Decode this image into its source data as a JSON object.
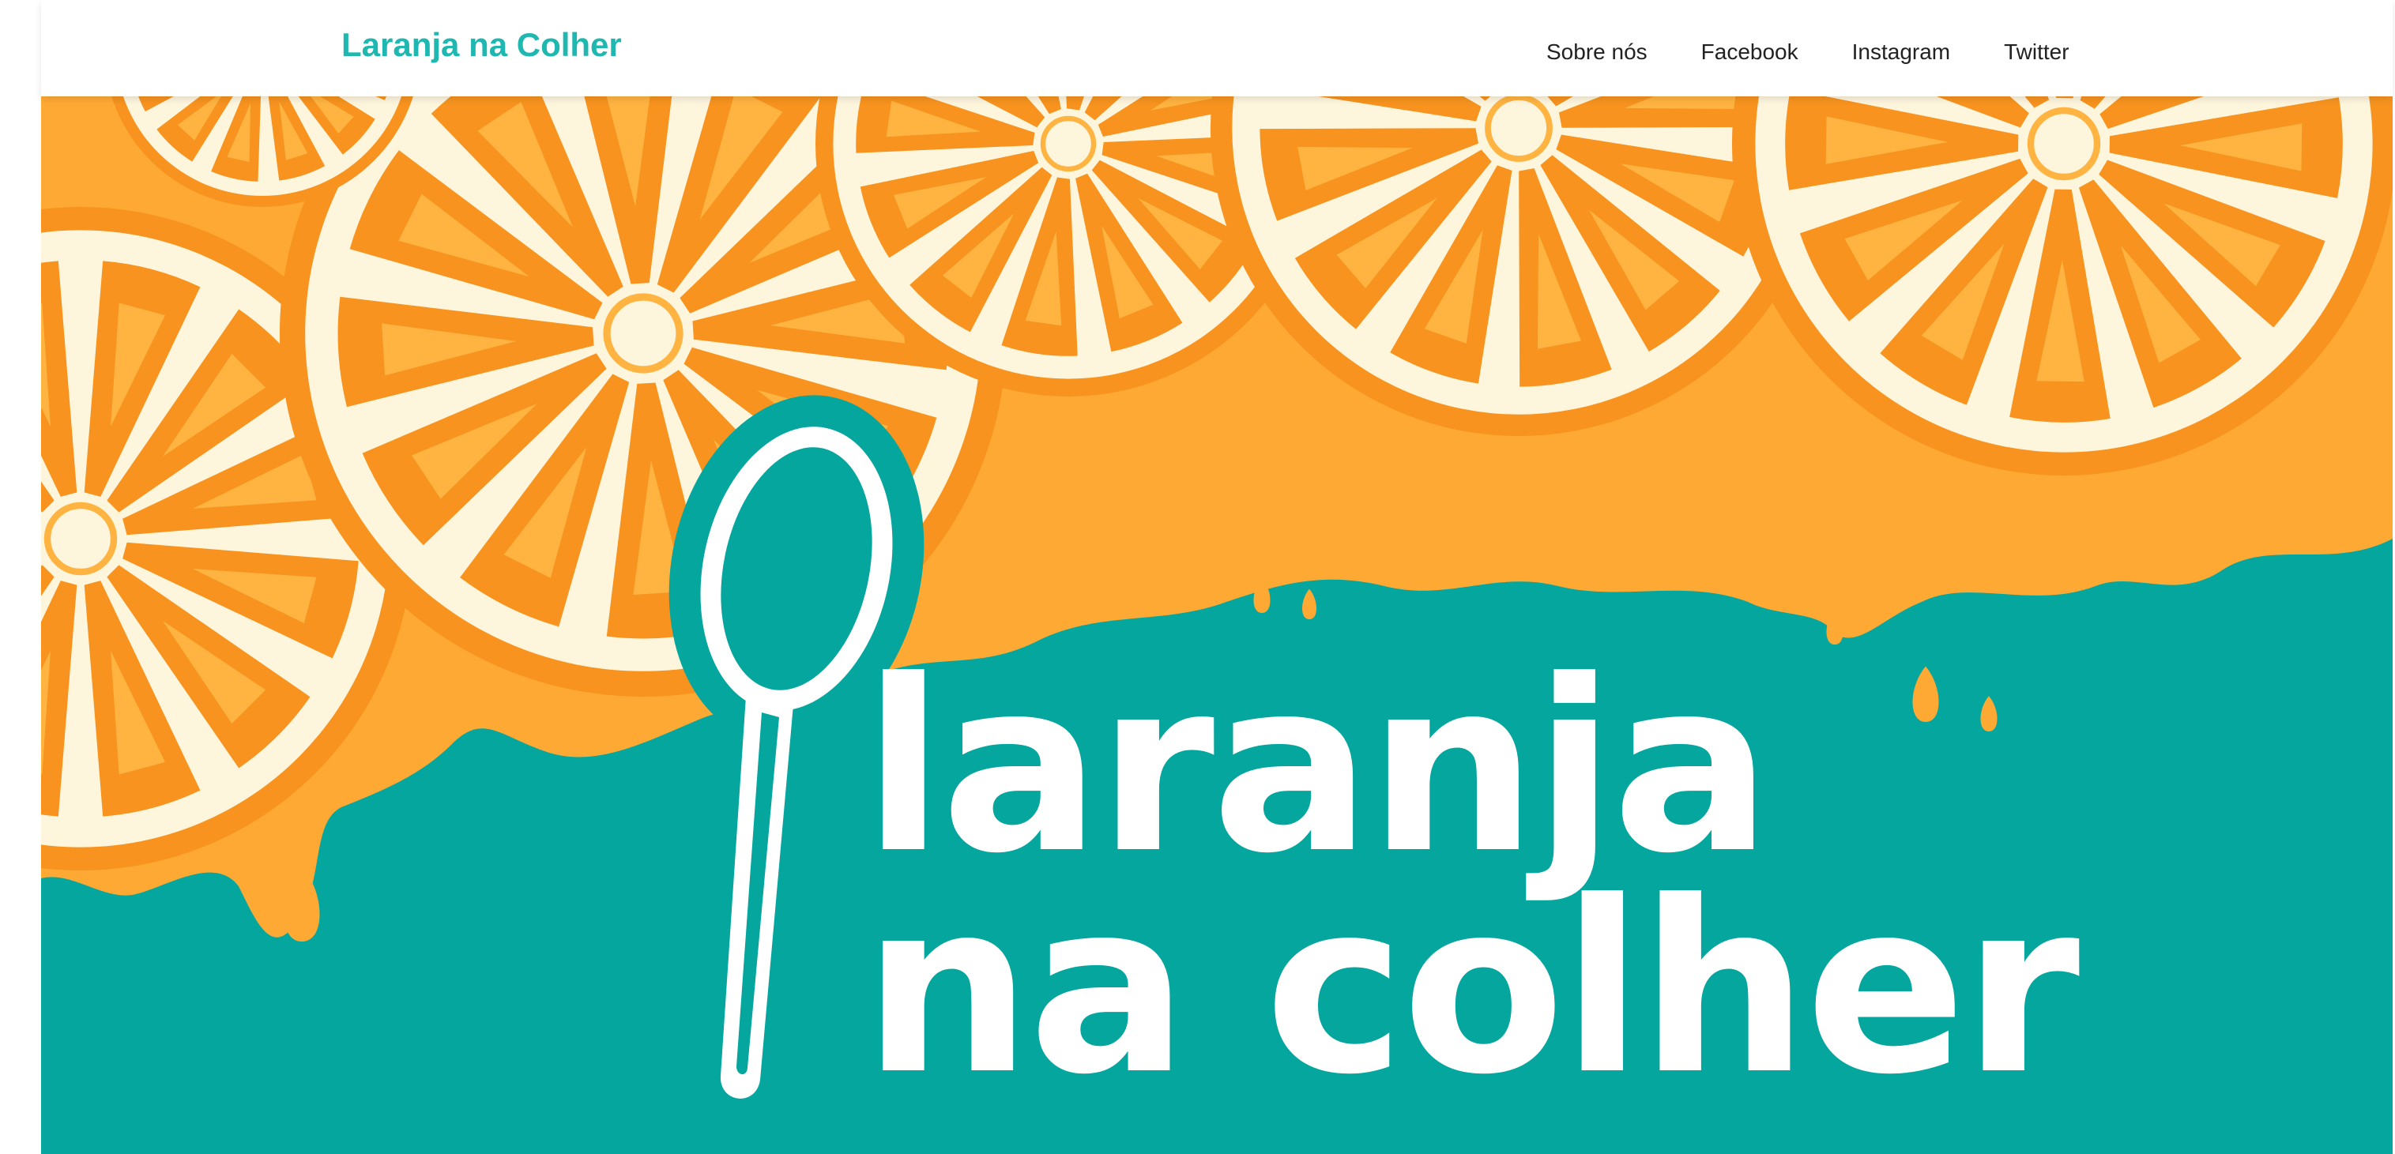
{
  "header": {
    "brand": "Laranja na Colher",
    "nav": [
      {
        "label": "Sobre nós"
      },
      {
        "label": "Facebook"
      },
      {
        "label": "Instagram"
      },
      {
        "label": "Twitter"
      }
    ]
  },
  "hero": {
    "title_line1": "laranja",
    "title_line2": "na colher",
    "icons": [
      "orange-slice-icon",
      "spoon-icon",
      "juice-drip-icon"
    ]
  },
  "colors": {
    "brand": "#1fb8b0",
    "teal_background": "#04a69e",
    "orange": "#f7931e",
    "orange_light": "#ffb340",
    "rind": "#fdf5dc",
    "text": "#222222"
  }
}
